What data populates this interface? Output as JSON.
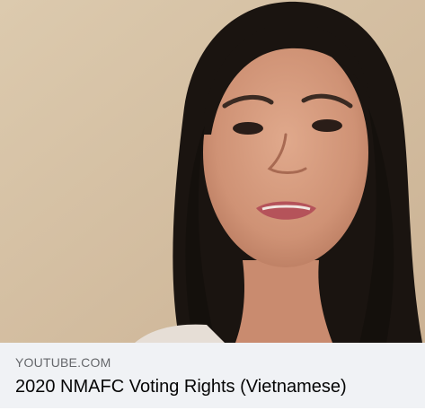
{
  "link_preview": {
    "domain": "YOUTUBE.COM",
    "title": "2020 NMAFC Voting Rights (Vietnamese)"
  }
}
